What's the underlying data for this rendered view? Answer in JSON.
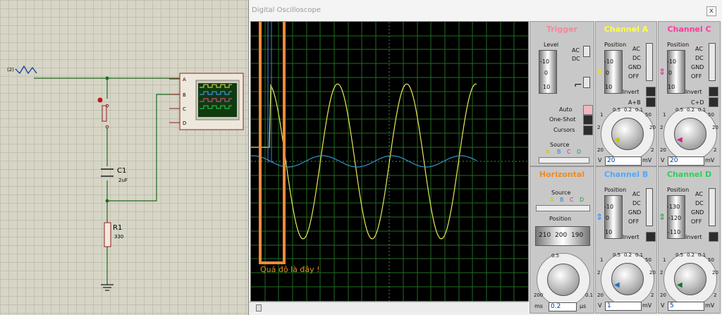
{
  "schematic": {
    "source_label": "(2)",
    "scope_pins": [
      "A",
      "B",
      "C",
      "D"
    ],
    "c1": {
      "name": "C1",
      "value": "2uF"
    },
    "r1": {
      "name": "R1",
      "value": "330"
    }
  },
  "window": {
    "title": "Digital Oscilloscope",
    "close": "x"
  },
  "annotation": {
    "text": "Quá độ là đây !"
  },
  "trigger": {
    "title": "Trigger",
    "title_color": "#f08a9a",
    "level_label": "Level",
    "level_ticks": [
      "-10",
      "0",
      "10"
    ],
    "coupling": [
      "AC",
      "DC"
    ],
    "modes": [
      "Auto",
      "One-Shot",
      "Cursors"
    ],
    "source_label": "Source",
    "source_channels": [
      "A",
      "B",
      "C",
      "D"
    ]
  },
  "channel_a": {
    "title": "Channel A",
    "title_color": "#ffff40",
    "position_label": "Position",
    "position_ticks": [
      "-10",
      "0",
      "10"
    ],
    "coupling": [
      "AC",
      "DC",
      "GND",
      "OFF"
    ],
    "invert_label": "Invert",
    "combine_label": "A+B",
    "dial_marks": [
      "0.5",
      "0.2",
      "0.1",
      "50",
      "1",
      "20",
      "2",
      "10",
      "5",
      "5",
      "10",
      "2",
      "20",
      "1"
    ],
    "dial_min": "20",
    "dial_max": "2",
    "readout": "20",
    "unit_left": "V",
    "unit_right": "mV"
  },
  "channel_b": {
    "title": "Channel B",
    "title_color": "#50a8ff",
    "position_label": "Position",
    "position_ticks": [
      "-10",
      "0",
      "10"
    ],
    "coupling": [
      "AC",
      "DC",
      "GND",
      "OFF"
    ],
    "invert_label": "Invert",
    "dial_marks": [
      "0.5",
      "0.2",
      "0.1",
      "50",
      "1",
      "20",
      "2",
      "10",
      "5",
      "5",
      "10",
      "2",
      "20",
      "1"
    ],
    "dial_min": "20",
    "dial_max": "2",
    "readout": "1",
    "unit_left": "V",
    "unit_right": "mV"
  },
  "channel_c": {
    "title": "Channel C",
    "title_color": "#ff3a9a",
    "position_label": "Position",
    "position_ticks": [
      "-10",
      "0",
      "10"
    ],
    "coupling": [
      "AC",
      "DC",
      "GND",
      "OFF"
    ],
    "invert_label": "Invert",
    "combine_label": "C+D",
    "dial_marks": [
      "0.5",
      "0.2",
      "0.1",
      "50",
      "1",
      "20",
      "2",
      "10",
      "5",
      "5",
      "10",
      "2",
      "20",
      "1"
    ],
    "dial_min": "20",
    "dial_max": "2",
    "readout": "20",
    "unit_left": "V",
    "unit_right": "mV"
  },
  "channel_d": {
    "title": "Channel D",
    "title_color": "#2fcf5a",
    "position_label": "Position",
    "position_ticks": [
      "-130",
      "-120",
      "-110"
    ],
    "coupling": [
      "AC",
      "DC",
      "GND",
      "OFF"
    ],
    "invert_label": "Invert",
    "dial_marks": [
      "0.5",
      "0.2",
      "0.1",
      "50",
      "1",
      "20",
      "2",
      "10",
      "5",
      "5",
      "10",
      "2",
      "20",
      "1"
    ],
    "dial_min": "20",
    "dial_max": "2",
    "readout": "5",
    "unit_left": "V",
    "unit_right": "mV"
  },
  "horizontal": {
    "title": "Horizontal",
    "title_color": "#f08a20",
    "source_label": "Source",
    "source_channels": [
      "A",
      "B",
      "C",
      "D"
    ],
    "position_label": "Position",
    "position_ticks": [
      "210",
      "200",
      "190"
    ],
    "dial_marks": [
      "0.5",
      "0.2",
      "0.1",
      "50",
      "1",
      "20",
      "2",
      "10",
      "5",
      "5",
      "10",
      "2",
      "20",
      "1",
      "50",
      "0.5",
      "100",
      "0.2"
    ],
    "dial_min": "200",
    "dial_max": "0.1",
    "readout": "0.2",
    "unit_left": "ms",
    "unit_right": "µs"
  },
  "colors": {
    "channel_a": "#e8e85a",
    "channel_b": "#3399cc",
    "grid": "#1f6e1f",
    "highlight": "#f08a3a"
  }
}
